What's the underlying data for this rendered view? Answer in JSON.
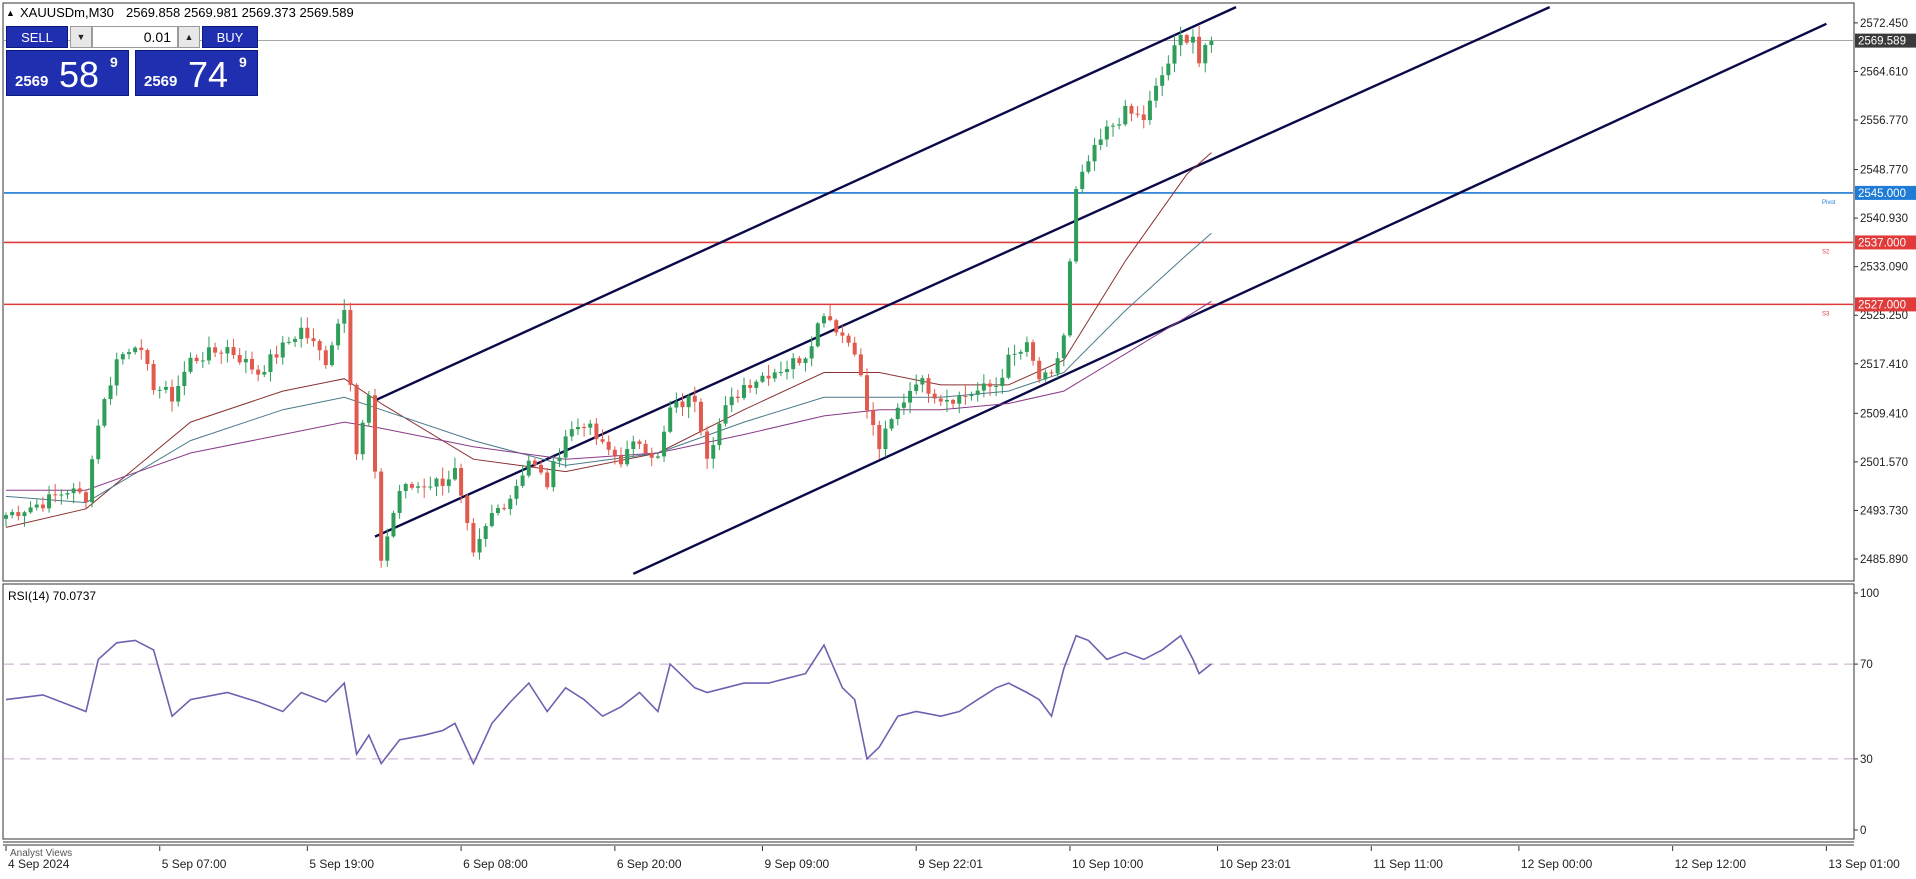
{
  "chart_header": {
    "symbol_label": "XAUUSDm,M30",
    "ohlc_label": "2569.858 2569.981 2569.373 2569.589"
  },
  "trade_panel": {
    "sell_label": "SELL",
    "buy_label": "BUY",
    "volume": "0.01",
    "sell_price": {
      "prefix": "2569",
      "big": "58",
      "sup": "9"
    },
    "buy_price": {
      "prefix": "2569",
      "big": "74",
      "sup": "9"
    }
  },
  "colors": {
    "bull": "#2e9e5a",
    "bear": "#e05a4e",
    "channel": "#0a0a4a",
    "pivot": "#1e7bd6",
    "support": "#e03a3a",
    "ma_fast": "#8a3030",
    "ma_mid": "#4a7a8a",
    "ma_slow": "#8a3a8a",
    "rsi": "#7060b0"
  },
  "chart_data": [
    {
      "type": "candlestick",
      "symbol": "XAUUSDm",
      "timeframe": "M30",
      "ylim": [
        2482.5,
        2575.5
      ],
      "y_ticks": [
        "2572.450",
        "2564.610",
        "2556.770",
        "2548.770",
        "2540.930",
        "2533.090",
        "2525.250",
        "2517.410",
        "2509.410",
        "2501.570",
        "2493.730",
        "2485.890"
      ],
      "x_ticks": [
        "4 Sep 2024",
        "5 Sep 07:00",
        "5 Sep 19:00",
        "6 Sep 08:00",
        "6 Sep 20:00",
        "9 Sep 09:00",
        "9 Sep 22:01",
        "10 Sep 10:00",
        "10 Sep 23:01",
        "11 Sep 11:00",
        "12 Sep 00:00",
        "12 Sep 12:00",
        "13 Sep 01:00"
      ],
      "x_tick_bars": [
        0,
        25,
        49,
        74,
        99,
        123,
        148,
        173,
        197,
        222,
        246,
        271,
        296
      ],
      "total_bars": 305,
      "current_price": {
        "value": 2569.589,
        "label": "2569.589"
      },
      "horizontal_levels": [
        {
          "value": 2545.0,
          "label": "2545.000",
          "tag": "Pivot",
          "color": "#1e7bd6"
        },
        {
          "value": 2537.0,
          "label": "2537.000",
          "tag": "S2",
          "color": "#e03a3a"
        },
        {
          "value": 2527.0,
          "label": "2527.000",
          "tag": "S3",
          "color": "#e03a3a"
        }
      ],
      "channel_lines": [
        {
          "from": {
            "bar": 60,
            "price": 2511.5
          },
          "to": {
            "bar": 200,
            "price": 2575.0
          }
        },
        {
          "from": {
            "bar": 60,
            "price": 2489.5
          },
          "to": {
            "bar": 251,
            "price": 2575.0
          }
        },
        {
          "from": {
            "bar": 102,
            "price": 2483.5
          },
          "to": {
            "bar": 296,
            "price": 2572.3
          }
        }
      ],
      "price_anchors": [
        [
          0,
          2493.0
        ],
        [
          6,
          2495.0
        ],
        [
          10,
          2497.0
        ],
        [
          13,
          2496.0
        ],
        [
          15,
          2508.0
        ],
        [
          18,
          2518.0
        ],
        [
          21,
          2521.0
        ],
        [
          24,
          2514.0
        ],
        [
          27,
          2512.0
        ],
        [
          30,
          2518.0
        ],
        [
          36,
          2520.0
        ],
        [
          41,
          2516.0
        ],
        [
          45,
          2520.0
        ],
        [
          48,
          2523.0
        ],
        [
          52,
          2518.0
        ],
        [
          55,
          2527.0
        ],
        [
          57,
          2503.0
        ],
        [
          59,
          2512.0
        ],
        [
          61,
          2486.0
        ],
        [
          64,
          2497.0
        ],
        [
          68,
          2498.0
        ],
        [
          71,
          2498.5
        ],
        [
          73,
          2500.0
        ],
        [
          76,
          2486.0
        ],
        [
          79,
          2493.0
        ],
        [
          82,
          2496.0
        ],
        [
          85,
          2502.0
        ],
        [
          88,
          2498.0
        ],
        [
          91,
          2506.0
        ],
        [
          94,
          2508.0
        ],
        [
          97,
          2504.0
        ],
        [
          100,
          2502.0
        ],
        [
          103,
          2505.0
        ],
        [
          106,
          2502.0
        ],
        [
          108,
          2510.0
        ],
        [
          112,
          2512.0
        ],
        [
          114,
          2503.0
        ],
        [
          117,
          2510.0
        ],
        [
          120,
          2514.0
        ],
        [
          124,
          2516.0
        ],
        [
          127,
          2517.0
        ],
        [
          130,
          2519.0
        ],
        [
          133,
          2526.0
        ],
        [
          136,
          2522.0
        ],
        [
          138,
          2520.0
        ],
        [
          140,
          2510.0
        ],
        [
          142,
          2504.0
        ],
        [
          145,
          2510.0
        ],
        [
          148,
          2515.0
        ],
        [
          152,
          2512.0
        ],
        [
          155,
          2512.0
        ],
        [
          158,
          2513.0
        ],
        [
          161,
          2514.0
        ],
        [
          163,
          2518.0
        ],
        [
          166,
          2520.0
        ],
        [
          168,
          2515.0
        ],
        [
          170,
          2515.0
        ],
        [
          172,
          2522.0
        ],
        [
          174,
          2545.0
        ],
        [
          176,
          2550.0
        ],
        [
          179,
          2555.0
        ],
        [
          182,
          2558.0
        ],
        [
          185,
          2557.0
        ],
        [
          188,
          2564.0
        ],
        [
          191,
          2570.0
        ],
        [
          193,
          2570.5
        ],
        [
          194,
          2566.0
        ],
        [
          196,
          2569.589
        ]
      ],
      "moving_averages": [
        {
          "color": "#8a3030",
          "points": [
            [
              0,
              2491.0
            ],
            [
              13,
              2494.0
            ],
            [
              30,
              2508.0
            ],
            [
              45,
              2513.0
            ],
            [
              55,
              2515.0
            ],
            [
              61,
              2511.0
            ],
            [
              76,
              2502.0
            ],
            [
              91,
              2500.0
            ],
            [
              106,
              2503.0
            ],
            [
              120,
              2510.0
            ],
            [
              133,
              2516.0
            ],
            [
              142,
              2516.0
            ],
            [
              152,
              2514.0
            ],
            [
              163,
              2514.0
            ],
            [
              172,
              2518.0
            ],
            [
              182,
              2534.0
            ],
            [
              192,
              2548.0
            ],
            [
              196,
              2551.5
            ]
          ]
        },
        {
          "color": "#4a7a8a",
          "points": [
            [
              0,
              2496.0
            ],
            [
              13,
              2495.0
            ],
            [
              30,
              2505.0
            ],
            [
              45,
              2510.0
            ],
            [
              55,
              2512.0
            ],
            [
              61,
              2510.0
            ],
            [
              76,
              2505.0
            ],
            [
              91,
              2501.0
            ],
            [
              106,
              2503.0
            ],
            [
              120,
              2508.0
            ],
            [
              133,
              2512.0
            ],
            [
              142,
              2512.0
            ],
            [
              152,
              2512.0
            ],
            [
              163,
              2513.0
            ],
            [
              172,
              2516.0
            ],
            [
              182,
              2526.0
            ],
            [
              192,
              2535.0
            ],
            [
              196,
              2538.5
            ]
          ]
        },
        {
          "color": "#8a3a8a",
          "points": [
            [
              0,
              2497.0
            ],
            [
              13,
              2497.0
            ],
            [
              30,
              2503.0
            ],
            [
              45,
              2506.0
            ],
            [
              55,
              2508.0
            ],
            [
              61,
              2507.0
            ],
            [
              76,
              2504.0
            ],
            [
              91,
              2502.0
            ],
            [
              106,
              2503.0
            ],
            [
              120,
              2506.0
            ],
            [
              133,
              2509.0
            ],
            [
              142,
              2510.0
            ],
            [
              152,
              2510.0
            ],
            [
              163,
              2511.0
            ],
            [
              172,
              2513.0
            ],
            [
              182,
              2519.0
            ],
            [
              192,
              2525.0
            ],
            [
              196,
              2527.5
            ]
          ]
        }
      ]
    },
    {
      "type": "line",
      "title": "RSI(14) 70.0737",
      "ylim": [
        0,
        100
      ],
      "y_ticks": [
        "100",
        "70",
        "30",
        "0"
      ],
      "y_tick_values": [
        100,
        70,
        30,
        0
      ],
      "levels": [
        70,
        30
      ],
      "series": [
        {
          "points": [
            [
              0,
              55.0
            ],
            [
              6,
              57.0
            ],
            [
              10,
              53.0
            ],
            [
              13,
              50.0
            ],
            [
              15,
              72.0
            ],
            [
              18,
              79.0
            ],
            [
              21,
              80.0
            ],
            [
              24,
              76.0
            ],
            [
              27,
              48.0
            ],
            [
              30,
              55.0
            ],
            [
              36,
              58.0
            ],
            [
              41,
              54.0
            ],
            [
              45,
              50.0
            ],
            [
              48,
              58.0
            ],
            [
              52,
              54.0
            ],
            [
              55,
              62.0
            ],
            [
              57,
              32.0
            ],
            [
              59,
              40.0
            ],
            [
              61,
              28.0
            ],
            [
              64,
              38.0
            ],
            [
              68,
              40.0
            ],
            [
              71,
              42.0
            ],
            [
              73,
              45.0
            ],
            [
              76,
              28.0
            ],
            [
              79,
              45.0
            ],
            [
              82,
              54.0
            ],
            [
              85,
              62.0
            ],
            [
              88,
              50.0
            ],
            [
              91,
              60.0
            ],
            [
              94,
              55.0
            ],
            [
              97,
              48.0
            ],
            [
              100,
              52.0
            ],
            [
              103,
              58.0
            ],
            [
              106,
              50.0
            ],
            [
              108,
              70.0
            ],
            [
              112,
              60.0
            ],
            [
              114,
              58.0
            ],
            [
              117,
              60.0
            ],
            [
              120,
              62.0
            ],
            [
              124,
              62.0
            ],
            [
              127,
              64.0
            ],
            [
              130,
              66.0
            ],
            [
              133,
              78.0
            ],
            [
              136,
              60.0
            ],
            [
              138,
              55.0
            ],
            [
              140,
              30.0
            ],
            [
              142,
              35.0
            ],
            [
              145,
              48.0
            ],
            [
              148,
              50.0
            ],
            [
              152,
              48.0
            ],
            [
              155,
              50.0
            ],
            [
              158,
              55.0
            ],
            [
              161,
              60.0
            ],
            [
              163,
              62.0
            ],
            [
              166,
              58.0
            ],
            [
              168,
              55.0
            ],
            [
              170,
              48.0
            ],
            [
              172,
              68.0
            ],
            [
              174,
              82.0
            ],
            [
              176,
              80.0
            ],
            [
              179,
              72.0
            ],
            [
              182,
              75.0
            ],
            [
              185,
              72.0
            ],
            [
              188,
              76.0
            ],
            [
              191,
              82.0
            ],
            [
              193,
              72.0
            ],
            [
              194,
              66.0
            ],
            [
              196,
              70.07
            ]
          ]
        }
      ]
    }
  ],
  "footer": {
    "label": "Analyst Views"
  }
}
